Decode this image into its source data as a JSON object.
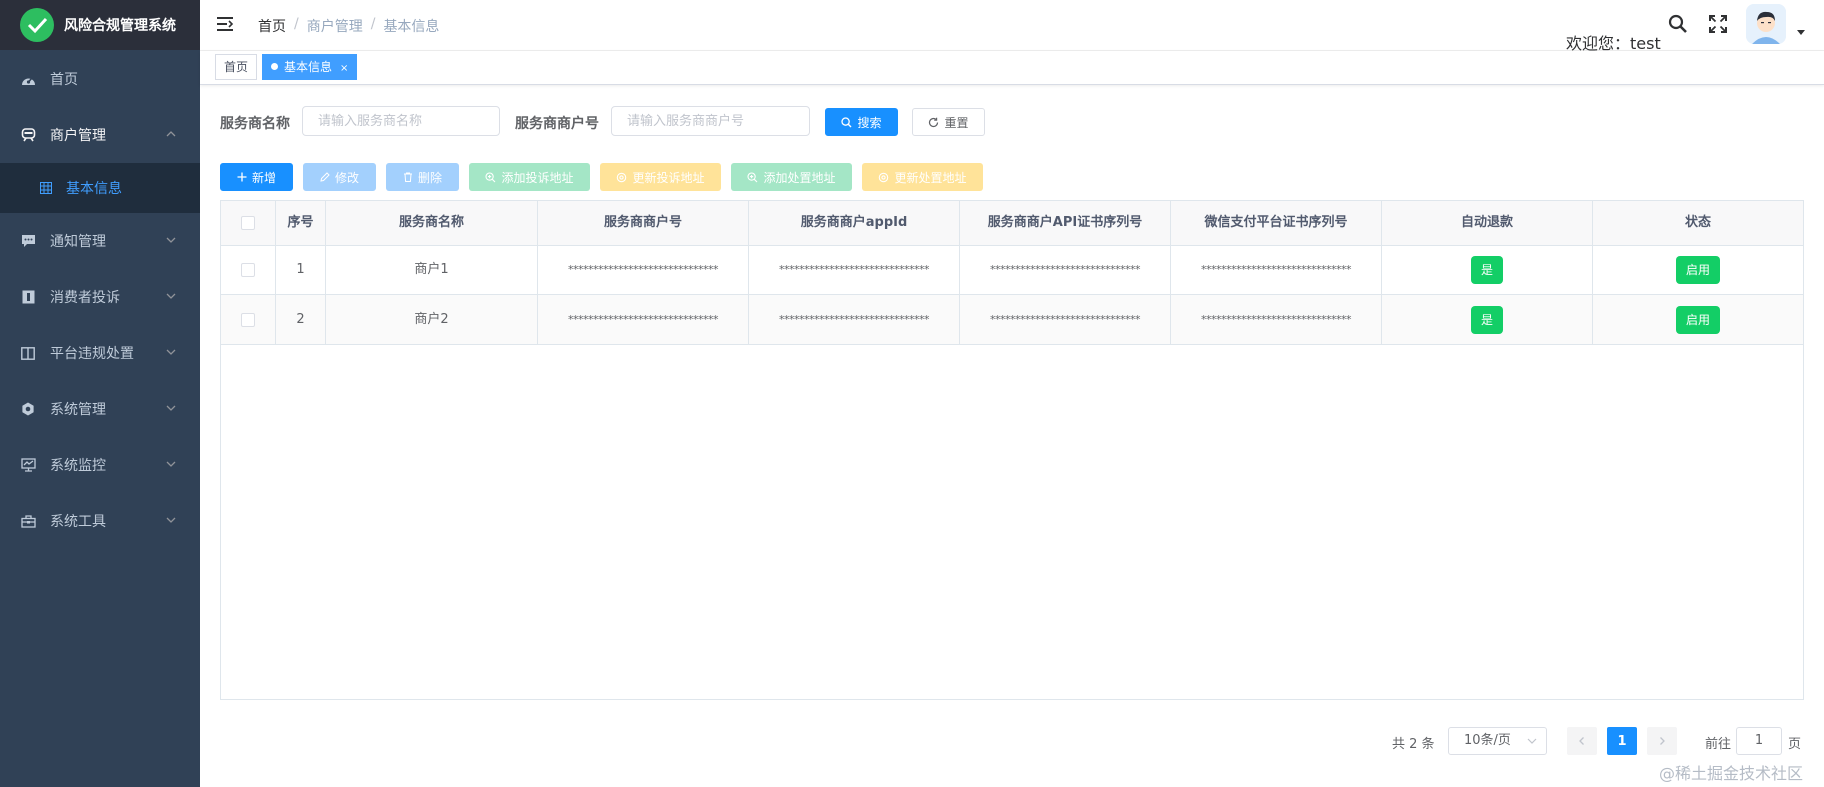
{
  "app": {
    "title": "风险合规管理系统"
  },
  "sidebar": {
    "items": [
      {
        "label": "首页",
        "icon": "dashboard-icon"
      },
      {
        "label": "商户管理",
        "icon": "merchant-icon",
        "expanded": true,
        "children": [
          {
            "label": "基本信息",
            "icon": "table-icon",
            "active": true
          }
        ]
      },
      {
        "label": "通知管理",
        "icon": "message-icon"
      },
      {
        "label": "消费者投诉",
        "icon": "complaint-icon"
      },
      {
        "label": "平台违规处置",
        "icon": "violation-icon"
      },
      {
        "label": "系统管理",
        "icon": "gear-icon"
      },
      {
        "label": "系统监控",
        "icon": "monitor-icon"
      },
      {
        "label": "系统工具",
        "icon": "toolbox-icon"
      }
    ]
  },
  "header": {
    "breadcrumb": [
      "首页",
      "商户管理",
      "基本信息"
    ],
    "breadcrumb_sep": "/",
    "welcome": "欢迎您：test"
  },
  "tags": {
    "home": "首页",
    "active": "基本信息",
    "close": "×"
  },
  "search": {
    "name_label": "服务商名称",
    "name_placeholder": "请输入服务商名称",
    "merchant_no_label": "服务商商户号",
    "merchant_no_placeholder": "请输入服务商商户号",
    "search_button": "搜索",
    "reset_button": "重置"
  },
  "toolbar": {
    "add": "新增",
    "edit": "修改",
    "delete": "删除",
    "add_complaint_url": "添加投诉地址",
    "update_complaint_url": "更新投诉地址",
    "add_handle_url": "添加处置地址",
    "update_handle_url": "更新处置地址"
  },
  "table": {
    "columns": [
      "",
      "序号",
      "服务商名称",
      "服务商商户号",
      "服务商商户appId",
      "服务商商户API证书序列号",
      "微信支付平台证书序列号",
      "自动退款",
      "状态"
    ],
    "rows": [
      {
        "index": "1",
        "name": "商户1",
        "merchant_no": "******************************",
        "appid": "******************************",
        "api_serial": "******************************",
        "wx_serial": "******************************",
        "auto_refund": "是",
        "status": "启用"
      },
      {
        "index": "2",
        "name": "商户2",
        "merchant_no": "******************************",
        "appid": "******************************",
        "api_serial": "******************************",
        "wx_serial": "******************************",
        "auto_refund": "是",
        "status": "启用"
      }
    ]
  },
  "pagination": {
    "total": "共 2 条",
    "page_size": "10条/页",
    "current": "1",
    "goto_prefix": "前往",
    "goto_value": "1",
    "goto_suffix": "页"
  },
  "watermark": "@稀土掘金技术社区",
  "colors": {
    "sidebar_bg": "#304156",
    "primary": "#1890ff",
    "success": "#13ce66",
    "warning_light": "#ffe399"
  }
}
